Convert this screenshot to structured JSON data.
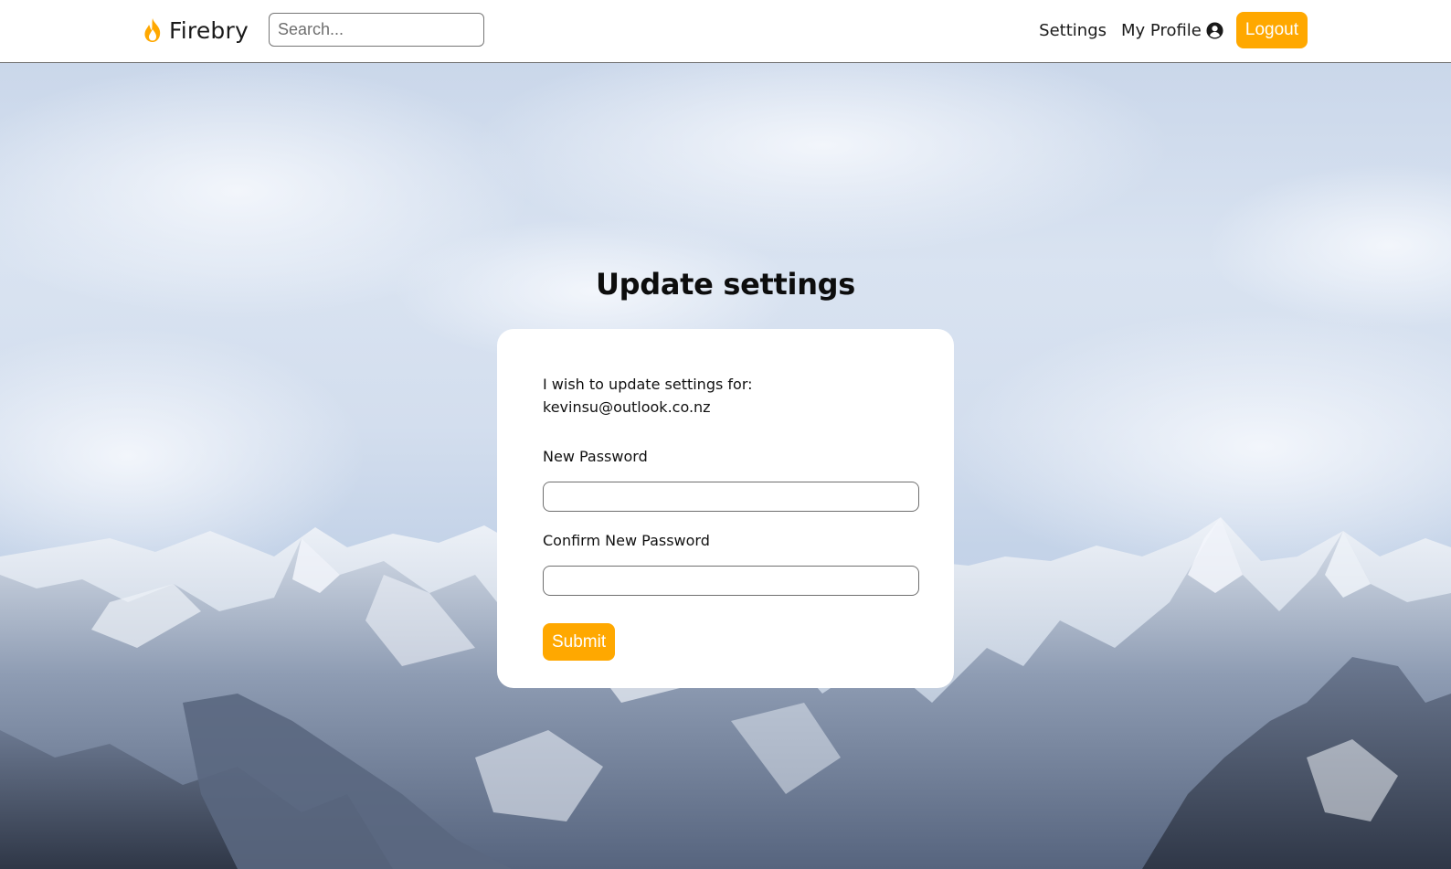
{
  "navbar": {
    "brand_name": "Firebry",
    "search_placeholder": "Search...",
    "search_value": "",
    "settings_label": "Settings",
    "profile_label": "My Profile",
    "logout_label": "Logout"
  },
  "page": {
    "title": "Update settings"
  },
  "form": {
    "intro_text": "I wish to update settings for:",
    "email": "kevinsu@outlook.co.nz",
    "new_password_label": "New Password",
    "new_password_value": "",
    "confirm_password_label": "Confirm New Password",
    "confirm_password_value": "",
    "submit_label": "Submit"
  },
  "theme": {
    "accent": "#ffa800",
    "nav_bg": "#ffffff",
    "card_bg": "#ffffff",
    "text": "#111111"
  },
  "icons": {
    "brand": "flame-icon",
    "profile": "user-circle-icon"
  }
}
